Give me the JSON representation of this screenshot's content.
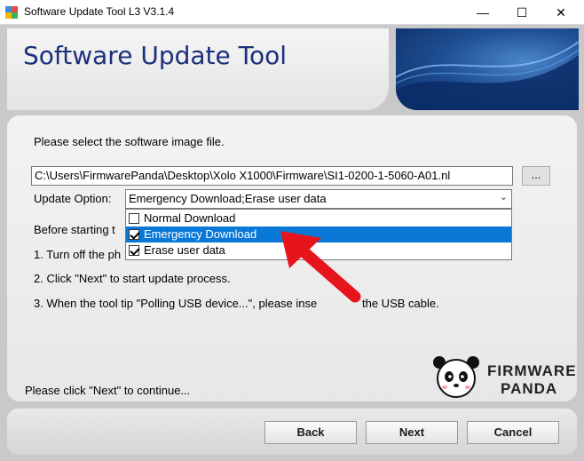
{
  "window": {
    "title": "Software Update Tool L3 V3.1.4",
    "minimize": "—",
    "maximize": "☐",
    "close": "✕"
  },
  "header": {
    "title": "Software Update Tool"
  },
  "main": {
    "select_prompt": "Please select the software image file.",
    "path_value": "C:\\Users\\FirmwarePanda\\Desktop\\Xolo X1000\\Firmware\\SI1-0200-1-5060-A01.nl",
    "browse_label": "...",
    "update_option_label": "Update Option:",
    "update_option_value": "Emergency Download;Erase user data",
    "options": [
      {
        "label": "Normal Download",
        "checked": false,
        "selected": false
      },
      {
        "label": "Emergency Download",
        "checked": true,
        "selected": true
      },
      {
        "label": "Erase user data",
        "checked": true,
        "selected": false
      }
    ],
    "before_text": "Before starting t",
    "step1": "1. Turn off the ph",
    "step2": "2. Click \"Next\" to start update process.",
    "step3_a": "3. When the tool tip \"Polling USB device...\", please inse",
    "step3_b": "the USB cable.",
    "continue_text": "Please click \"Next\" to continue..."
  },
  "logo": {
    "line1": "FIRMWARE",
    "line2": "PANDA"
  },
  "buttons": {
    "back": "Back",
    "next": "Next",
    "cancel": "Cancel"
  },
  "colors": {
    "selection": "#0a78d7",
    "title_blue": "#1b2f7c",
    "annotation_arrow": "#e8141b"
  }
}
